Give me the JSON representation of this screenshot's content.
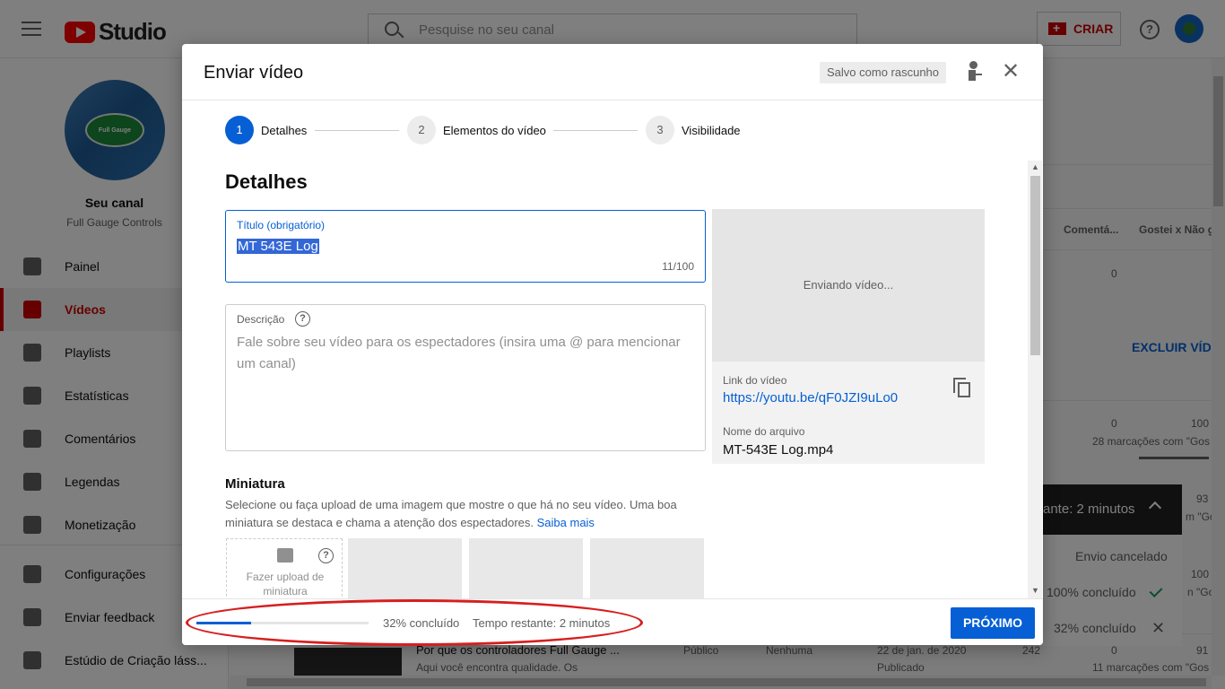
{
  "app": {
    "brand": "Studio",
    "search_placeholder": "Pesquise no seu canal",
    "create_label": "CRIAR",
    "help_glyph": "?"
  },
  "sidebar": {
    "channel_label": "Seu canal",
    "channel_name": "Full Gauge Controls",
    "avatar_text": "Full Gauge",
    "items": [
      {
        "label": "Painel",
        "icon": "dashboard-icon"
      },
      {
        "label": "Vídeos",
        "icon": "video-icon",
        "active": true
      },
      {
        "label": "Playlists",
        "icon": "playlist-icon"
      },
      {
        "label": "Estatísticas",
        "icon": "analytics-icon"
      },
      {
        "label": "Comentários",
        "icon": "comments-icon"
      },
      {
        "label": "Legendas",
        "icon": "subtitles-icon"
      },
      {
        "label": "Monetização",
        "icon": "dollar-icon"
      },
      {
        "label": "Configurações",
        "icon": "gear-icon"
      },
      {
        "label": "Enviar feedback",
        "icon": "feedback-icon"
      },
      {
        "label": "Estúdio de Criação láss...",
        "icon": "classic-studio-icon"
      }
    ]
  },
  "background": {
    "col_comments": "Comentá...",
    "col_likes": "Gostei x Não g",
    "row1_comments": "0",
    "delete_videos": "EXCLUIR VÍDE",
    "row2_comments": "0",
    "row2_likes": "100",
    "row2_likes_sub": "28 marcações com \"Gos",
    "row3_likes": "93",
    "row3_likes_sub": "m \"Gos",
    "row4_likes": "100",
    "row4_likes_sub": "n \"Gos",
    "row5_title": "Por que os controladores Full Gauge ...",
    "row5_desc": "Aqui você encontra qualidade. Os",
    "row5_visibility": "Público",
    "row5_restrictions": "Nenhuma",
    "row5_date": "22 de jan. de 2020",
    "row5_status": "Publicado",
    "row5_views": "242",
    "row5_comments": "0",
    "row5_likes": "91",
    "row5_likes_sub": "11 marcações com \"Gos"
  },
  "upload_panel": {
    "header": "ante: 2 minutos",
    "rows": [
      "Envio cancelado",
      "100% concluído",
      "32% concluído"
    ]
  },
  "modal": {
    "title": "Enviar vídeo",
    "draft_badge": "Salvo como rascunho",
    "close_glyph": "✕",
    "steps": [
      {
        "num": "1",
        "label": "Detalhes",
        "active": true
      },
      {
        "num": "2",
        "label": "Elementos do vídeo"
      },
      {
        "num": "3",
        "label": "Visibilidade"
      }
    ],
    "section_heading": "Detalhes",
    "title_field": {
      "label": "Título (obrigatório)",
      "value": "MT 543E Log",
      "counter": "11/100"
    },
    "description_field": {
      "label": "Descrição",
      "help_glyph": "?",
      "placeholder": "Fale sobre seu vídeo para os espectadores (insira uma @ para mencionar um canal)"
    },
    "thumbnail": {
      "heading": "Miniatura",
      "description": "Selecione ou faça upload de uma imagem que mostre o que há no seu vídeo. Uma boa miniatura se destaca e chama a atenção dos espectadores.",
      "learn_more": "Saiba mais",
      "upload_label": "Fazer upload de miniatura",
      "help_glyph": "?"
    },
    "preview": {
      "status": "Enviando vídeo...",
      "link_label": "Link do vídeo",
      "link_url": "https://youtu.be/qF0JZI9uLo0",
      "file_label": "Nome do arquivo",
      "file_name": "MT-543E Log.mp4"
    },
    "footer": {
      "progress_fraction": 0.32,
      "progress_text": "32% concluído",
      "time_remaining": "Tempo restante: 2 minutos",
      "next_label": "PRÓXIMO"
    }
  },
  "colors": {
    "brand_red": "#ff0000",
    "accent_blue": "#065fd4",
    "annotation_red": "#d61f1f"
  }
}
